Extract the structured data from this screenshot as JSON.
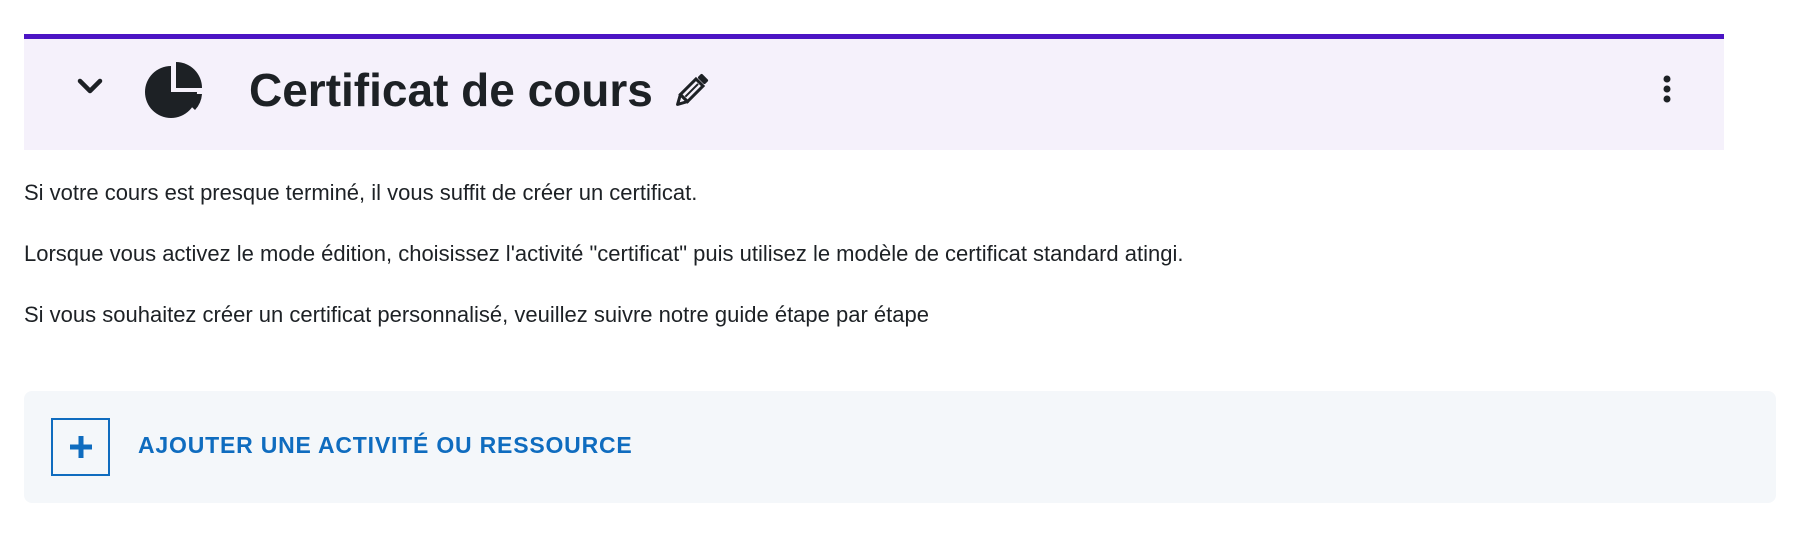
{
  "section": {
    "title": "Certificat de cours",
    "icons": {
      "collapse": "chevron-down-icon",
      "section_type": "pie-chart-icon",
      "edit": "pencil-icon",
      "menu": "kebab-menu-icon"
    },
    "colors": {
      "accent": "#4b14c4",
      "header_bg": "#f5f1fb",
      "text": "#1d2125"
    }
  },
  "summary": {
    "paragraphs": [
      "Si votre cours est presque terminé, il vous suffit de créer un certificat.",
      "Lorsque vous activez le mode édition, choisissez l'activité \"certificat\" puis utilisez le modèle de certificat standard atingi.",
      "Si vous souhaitez créer un certificat personnalisé, veuillez suivre notre guide étape par étape"
    ]
  },
  "add_activity": {
    "label": "AJOUTER UNE ACTIVITÉ OU RESSOURCE",
    "icon": "plus-icon",
    "color": "#0f6cbf",
    "bg": "#f4f7fa"
  }
}
